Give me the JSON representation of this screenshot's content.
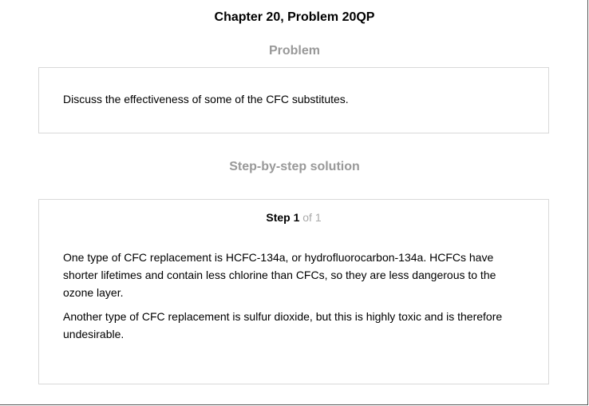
{
  "chapter_title": "Chapter 20, Problem 20QP",
  "problem": {
    "heading": "Problem",
    "text": "Discuss the effectiveness of some of the CFC substitutes."
  },
  "solution": {
    "heading": "Step-by-step solution",
    "step": {
      "label": "Step 1",
      "of_text": "of 1",
      "paragraphs": [
        "One type of CFC replacement is HCFC-134a, or hydrofluorocarbon-134a. HCFCs have shorter lifetimes and contain less chlorine than CFCs, so they are less dangerous to the ozone layer.",
        "Another type of CFC replacement is sulfur dioxide, but this is highly toxic and is therefore undesirable."
      ]
    }
  }
}
